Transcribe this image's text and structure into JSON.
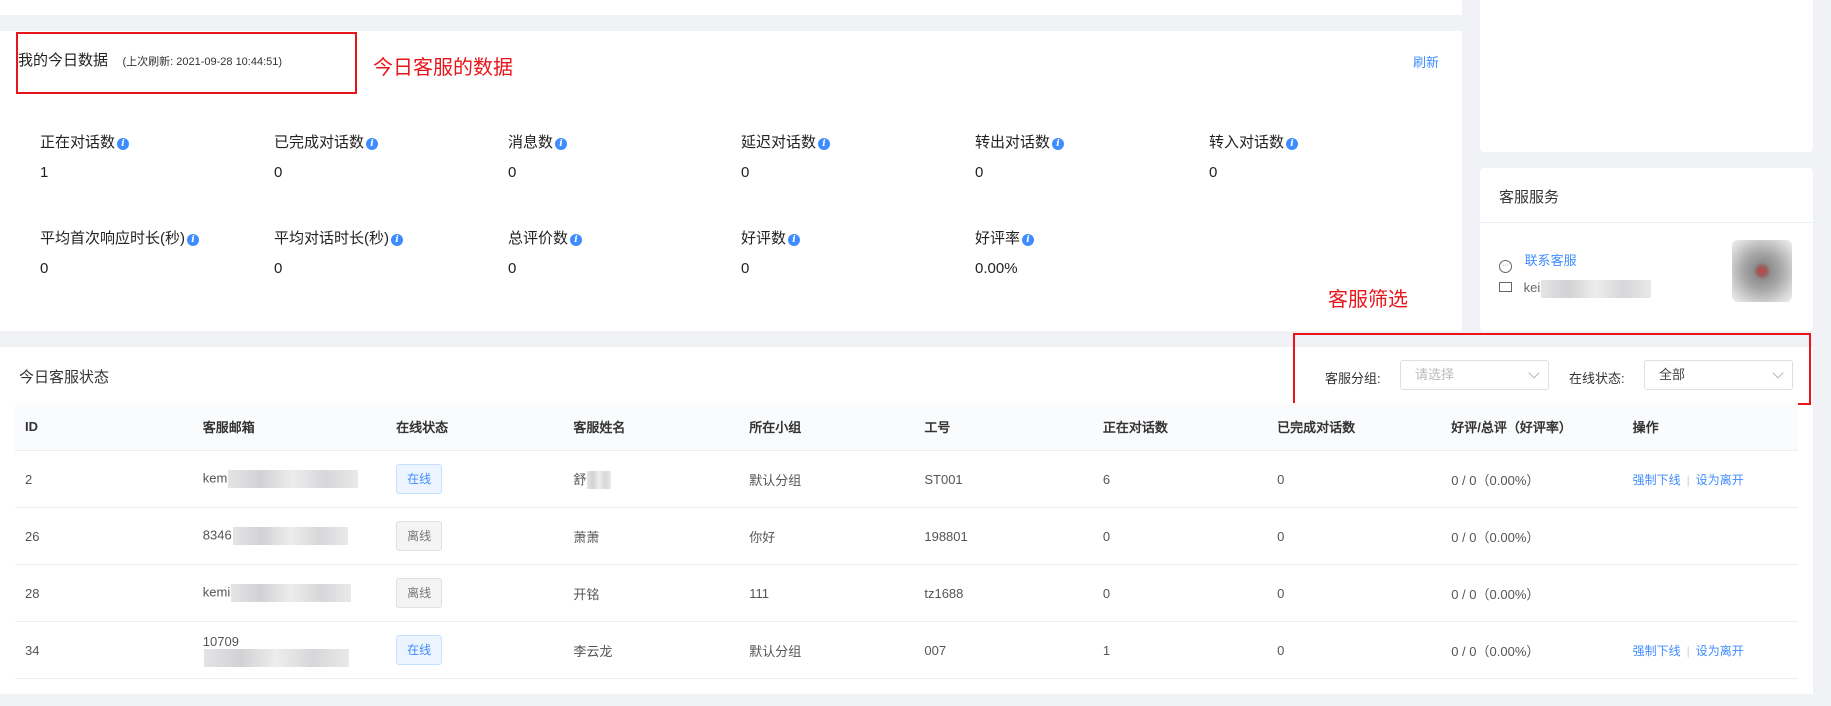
{
  "today": {
    "title": "我的今日数据",
    "last_refresh": "(上次刷新: 2021-09-28 10:44:51)",
    "refresh_label": "刷新",
    "stats": [
      {
        "label": "正在对话数",
        "value": "1"
      },
      {
        "label": "已完成对话数",
        "value": "0"
      },
      {
        "label": "消息数",
        "value": "0"
      },
      {
        "label": "延迟对话数",
        "value": "0"
      },
      {
        "label": "转出对话数",
        "value": "0"
      },
      {
        "label": "转入对话数",
        "value": "0"
      },
      {
        "label": "平均首次响应时长(秒)",
        "value": "0"
      },
      {
        "label": "平均对话时长(秒)",
        "value": "0"
      },
      {
        "label": "总评价数",
        "value": "0"
      },
      {
        "label": "好评数",
        "value": "0"
      },
      {
        "label": "好评率",
        "value": "0.00%"
      }
    ]
  },
  "annotations": {
    "today_data": "今日客服的数据",
    "filter": "客服筛选"
  },
  "service": {
    "title": "客服服务",
    "contact_label": "联系客服",
    "email_partial": "kei"
  },
  "status": {
    "title": "今日客服状态",
    "group_label": "客服分组:",
    "group_placeholder": "请选择",
    "online_label": "在线状态:",
    "online_value": "全部",
    "columns": [
      "ID",
      "客服邮箱",
      "在线状态",
      "客服姓名",
      "所在小组",
      "工号",
      "正在对话数",
      "已完成对话数",
      "好评/总评（好评率）",
      "操作"
    ],
    "rows": [
      {
        "id": "2",
        "email": "kem",
        "status": "在线",
        "online": true,
        "name": "舒",
        "group": "默认分组",
        "job": "ST001",
        "active": "6",
        "done": "0",
        "rating": "0 / 0（0.00%）",
        "force_label": "强制下线",
        "leave_label": "设为离开"
      },
      {
        "id": "26",
        "email": "8346",
        "status": "离线",
        "online": false,
        "name": "萧萧",
        "group": "你好",
        "job": "198801",
        "active": "0",
        "done": "0",
        "rating": "0 / 0（0.00%）"
      },
      {
        "id": "28",
        "email": "kemi",
        "status": "离线",
        "online": false,
        "name": "开铭",
        "group": "111",
        "job": "tz1688",
        "active": "0",
        "done": "0",
        "rating": "0 / 0（0.00%）"
      },
      {
        "id": "34",
        "email": "10709",
        "status": "在线",
        "online": true,
        "name": "李云龙",
        "group": "默认分组",
        "job": "007",
        "active": "1",
        "done": "0",
        "rating": "0 / 0（0.00%）",
        "force_label": "强制下线",
        "leave_label": "设为离开"
      }
    ]
  }
}
